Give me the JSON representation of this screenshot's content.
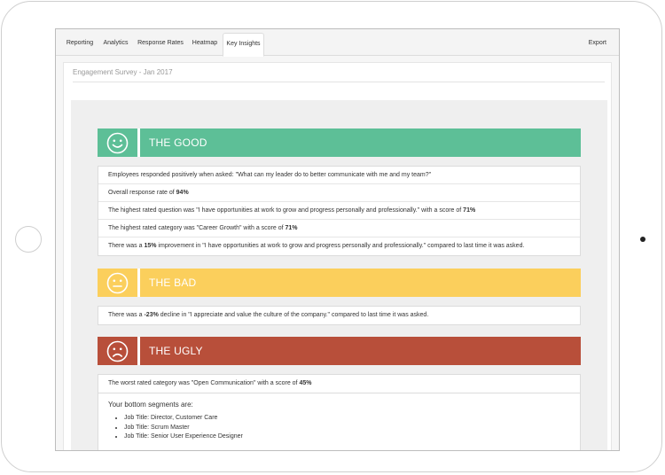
{
  "nav": {
    "tabs": [
      {
        "label": "Reporting"
      },
      {
        "label": "Analytics"
      },
      {
        "label": "Response Rates"
      },
      {
        "label": "Heatmap"
      },
      {
        "label": "Key Insights"
      }
    ],
    "active_tab": "Key Insights",
    "export_label": "Export"
  },
  "survey": {
    "title": "Engagement Survey - Jan 2017"
  },
  "colors": {
    "good": "#5dbf97",
    "bad": "#fbcf5c",
    "ugly": "#b84f3a"
  },
  "sections": {
    "good": {
      "heading": "THE GOOD",
      "icon": "smile-icon",
      "items": [
        {
          "pre": "Employees responded positively when asked: \"What can my leader do to better communicate with me and my team?\"",
          "bold": "",
          "post": ""
        },
        {
          "pre": "Overall response rate of ",
          "bold": "94%",
          "post": ""
        },
        {
          "pre": "The highest rated question was \"I have opportunities at work to grow and progress personally and professionally.\" with a score of ",
          "bold": "71%",
          "post": ""
        },
        {
          "pre": "The highest rated category was \"Career Growth\" with a score of ",
          "bold": "71%",
          "post": ""
        },
        {
          "pre": "There was a ",
          "bold": "15%",
          "post": " improvement in \"I have opportunities at work to grow and progress personally and professionally.\" compared to last time it was asked."
        }
      ]
    },
    "bad": {
      "heading": "THE BAD",
      "icon": "neutral-face-icon",
      "items": [
        {
          "pre": "There was a ",
          "bold": "-23%",
          "post": " decline in \"I appreciate and value the culture of the company.\" compared to last time it was asked."
        }
      ]
    },
    "ugly": {
      "heading": "THE UGLY",
      "icon": "frown-icon",
      "items": [
        {
          "pre": "The worst rated category was \"Open Communication\" with a score of ",
          "bold": "45%",
          "post": ""
        }
      ],
      "segments_title": "Your bottom segments are:",
      "segments": [
        "Job Title: Director, Customer Care",
        "Job Title: Scrum Master",
        "Job Title: Senior User Experience Designer"
      ]
    }
  }
}
